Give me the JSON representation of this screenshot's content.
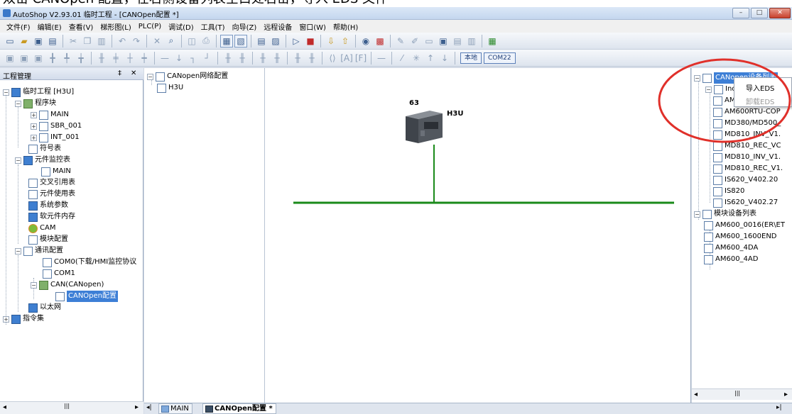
{
  "caption": {
    "text": "双击 CANOpen 配置，在右侧设备列表空白处右击，导入 EDS 文件"
  },
  "window": {
    "title": "AutoShop V2.93.01  临时工程 - [CANOpen配置 *]",
    "min": "–",
    "max": "□",
    "close": "✕"
  },
  "menu": [
    "文件(F)",
    "编辑(E)",
    "查看(V)",
    "梯形图(L)",
    "PLC(P)",
    "调试(D)",
    "工具(T)",
    "向导(Z)",
    "远程设备",
    "窗口(W)",
    "帮助(H)"
  ],
  "toolbar2": {
    "local_label": "本地",
    "com_label": "COM22"
  },
  "project": {
    "title": "工程管理",
    "pin": "‡",
    "close": "✕",
    "root": "临时工程 [H3U]",
    "program_block": "程序块",
    "main": "MAIN",
    "sbr": "SBR_001",
    "int": "INT_001",
    "symbol_table": "符号表",
    "monitor_table": "元件监控表",
    "monitor_main": "MAIN",
    "cross_ref": "交叉引用表",
    "usage_table": "元件使用表",
    "sys_params": "系统参数",
    "soft_memory": "软元件内存",
    "cam": "CAM",
    "module_config": "模块配置",
    "comm_config": "通讯配置",
    "com0": "COM0(下载/HMI监控协议",
    "com1": "COM1",
    "can": "CAN(CANopen)",
    "canopen_config": "CANOpen配置",
    "ethernet": "以太网",
    "instruction_set": "指令集",
    "toggle_minus": "−",
    "toggle_plus": "+"
  },
  "network_tree": {
    "root": "CANopen网络配置",
    "child": "H3U"
  },
  "diagram": {
    "node_id": "63",
    "device_label": "H3U",
    "bus_color": "#1a8a1a"
  },
  "device_list": {
    "root": "CANopen设备列表",
    "group1": "Inovance",
    "items": [
      "AM600RTU-COP",
      "MD380/MD500_",
      "MD810_INV_V1.",
      "MD810_REC_VC",
      "MD810_INV_V1.",
      "MD810_REC_V1.",
      "IS620_V402.20",
      "IS820",
      "IS620_V402.27"
    ],
    "group2": "模块设备列表",
    "items2": [
      "AM600_0016(ER\\ET",
      "AM600_1600END",
      "AM600_4DA",
      "AM600_4AD"
    ]
  },
  "context_menu": {
    "import": "导入EDS",
    "uninstall": "卸载EDS"
  },
  "annotation_color": "#e0302a",
  "bottom_tabs": {
    "tab1": "MAIN",
    "tab2": "CANOpen配置 *",
    "nav_left": "◂|",
    "nav_right": "▸|"
  },
  "scroll": {
    "left": "◂",
    "right": "▸",
    "grip": "|||"
  }
}
